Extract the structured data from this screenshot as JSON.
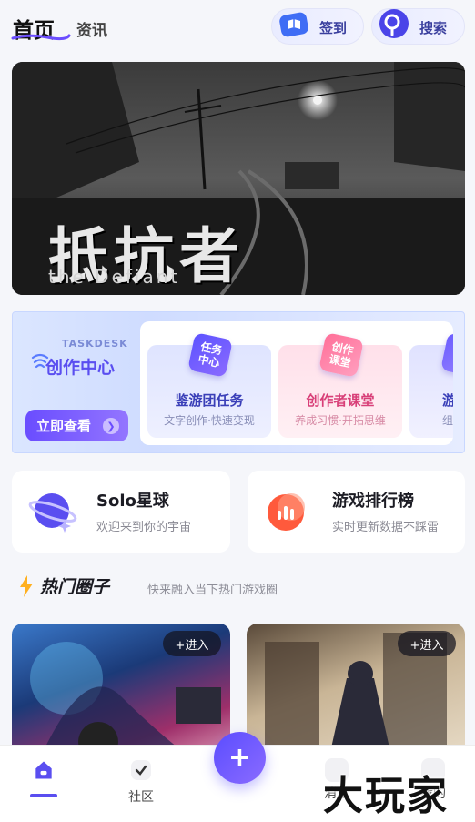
{
  "header": {
    "tab_home": "首页",
    "tab_news": "资讯",
    "signin_label": "签到",
    "search_label": "搜索"
  },
  "banner": {
    "title": "抵抗者",
    "subtitle": "the Defiant"
  },
  "taskdesk": {
    "brand_en": "TASKDESK",
    "title": "创作中心",
    "view_button": "立即查看",
    "cards": [
      {
        "badge": "任务\n中心",
        "title": "鉴游团任务",
        "desc": "文字创作·快速变现"
      },
      {
        "badge": "创作\n课堂",
        "title": "创作者课堂",
        "desc": "养成习惯·开拓思维"
      },
      {
        "badge": "",
        "title": "游",
        "desc": "组建区"
      }
    ]
  },
  "features": [
    {
      "title": "Solo星球",
      "subtitle": "欢迎来到你的宇宙",
      "icon": "planet-icon"
    },
    {
      "title": "游戏排行榜",
      "subtitle": "实时更新数据不踩雷",
      "icon": "chart-icon"
    }
  ],
  "hot": {
    "title": "热门圈子",
    "subtitle": "快来融入当下热门游戏圈",
    "join_label": "+进入"
  },
  "nav": {
    "home": "",
    "community": "社区",
    "message": "消息",
    "me": "我的"
  },
  "watermark": "大玩家",
  "colors": {
    "accent": "#5a4ef0",
    "background": "#f5f6fa"
  }
}
